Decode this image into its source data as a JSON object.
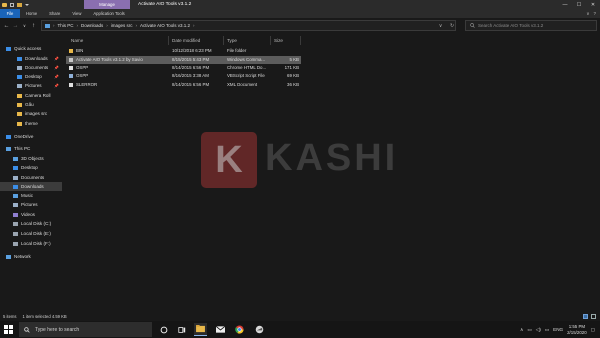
{
  "titlebar": {
    "manage_tab": "Manage",
    "title": "Activate AIO Tools v3.1.2",
    "minimize": "—",
    "maximize": "☐",
    "close": "✕"
  },
  "ribbon": {
    "tabs": [
      "File",
      "Home",
      "Share",
      "View",
      "Application Tools"
    ],
    "help_icon": "?"
  },
  "nav": {
    "back": "←",
    "forward": "→",
    "recent": "∨",
    "up": "↑",
    "path": [
      "This PC",
      "Downloads",
      "images src",
      "Activate AIO Tools v3.1.2"
    ],
    "dropdown": "∨",
    "refresh": "↻",
    "search_placeholder": "Search Activate AIO Tools v3.1.2"
  },
  "sidebar": {
    "items": [
      {
        "label": "Quick access",
        "icon": "star-icon",
        "color": "#3b8ee8",
        "pin": ""
      },
      {
        "label": "Downloads",
        "icon": "download-icon",
        "color": "#3b8ee8",
        "pin": "📌"
      },
      {
        "label": "Documents",
        "icon": "document-icon",
        "color": "#9bb0c8",
        "pin": "📌"
      },
      {
        "label": "Desktop",
        "icon": "desktop-icon",
        "color": "#3b8ee8",
        "pin": "📌"
      },
      {
        "label": "Pictures",
        "icon": "pictures-icon",
        "color": "#9bb0c8",
        "pin": "📌"
      },
      {
        "label": "Camera Roll",
        "icon": "folder-icon",
        "color": "#e8b84a",
        "pin": ""
      },
      {
        "label": "Gấu",
        "icon": "folder-icon",
        "color": "#e8b84a",
        "pin": ""
      },
      {
        "label": "images src",
        "icon": "folder-icon",
        "color": "#e8b84a",
        "pin": ""
      },
      {
        "label": "theme",
        "icon": "folder-icon",
        "color": "#e8b84a",
        "pin": ""
      },
      {
        "label": "OneDrive",
        "icon": "cloud-icon",
        "color": "#3b8ee8",
        "pin": ""
      },
      {
        "label": "This PC",
        "icon": "pc-icon",
        "color": "#5aa0e0",
        "pin": ""
      },
      {
        "label": "3D Objects",
        "icon": "cube-icon",
        "color": "#5aa0e0",
        "pin": ""
      },
      {
        "label": "Desktop",
        "icon": "desktop-icon",
        "color": "#3b8ee8",
        "pin": ""
      },
      {
        "label": "Documents",
        "icon": "document-icon",
        "color": "#9bb0c8",
        "pin": ""
      },
      {
        "label": "Downloads",
        "icon": "download-icon",
        "color": "#3b8ee8",
        "pin": ""
      },
      {
        "label": "Music",
        "icon": "music-icon",
        "color": "#5aa0e0",
        "pin": ""
      },
      {
        "label": "Pictures",
        "icon": "pictures-icon",
        "color": "#9bb0c8",
        "pin": ""
      },
      {
        "label": "Videos",
        "icon": "video-icon",
        "color": "#8f7fd0",
        "pin": ""
      },
      {
        "label": "Local Disk (C:)",
        "icon": "disk-icon",
        "color": "#9aa4b0",
        "pin": ""
      },
      {
        "label": "Local Disk (E:)",
        "icon": "disk-icon",
        "color": "#9aa4b0",
        "pin": ""
      },
      {
        "label": "Local Disk (F:)",
        "icon": "disk-icon",
        "color": "#9aa4b0",
        "pin": ""
      },
      {
        "label": "Network",
        "icon": "network-icon",
        "color": "#5aa0e0",
        "pin": ""
      }
    ]
  },
  "table": {
    "headers": [
      "Name",
      "Date modified",
      "Type",
      "Size"
    ],
    "rows": [
      {
        "name": "BIN",
        "date": "10/12/2018 6:23 PM",
        "type": "File folder",
        "size": "",
        "icon": "folder-icon",
        "color": "#e8b84a"
      },
      {
        "name": "Activate AIO Tools v3.1.2 by Savio",
        "date": "8/15/2015 5:43 PM",
        "type": "Windows Comma...",
        "size": "5 KB",
        "icon": "cmd-icon",
        "color": "#c8c8c8"
      },
      {
        "name": "OSPP",
        "date": "8/14/2015 6:56 PM",
        "type": "Chrome HTML Do...",
        "size": "171 KB",
        "icon": "chrome-doc-icon",
        "color": "#e0e0e0"
      },
      {
        "name": "OSPP",
        "date": "8/16/2015 3:38 AM",
        "type": "VBScript Script File",
        "size": "69 KB",
        "icon": "script-icon",
        "color": "#8fb0d8"
      },
      {
        "name": "SLERROR",
        "date": "8/14/2015 6:56 PM",
        "type": "XML Document",
        "size": "36 KB",
        "icon": "xml-icon",
        "color": "#e0e0e0"
      }
    ]
  },
  "watermark": {
    "letter": "K",
    "text": "KASHI"
  },
  "status": {
    "count": "5 items",
    "selected": "1 item selected  4.59 KB"
  },
  "taskbar": {
    "search_placeholder": "Type here to search",
    "language": "ENG",
    "time": "1:55 PM",
    "date": "2/15/2020"
  }
}
